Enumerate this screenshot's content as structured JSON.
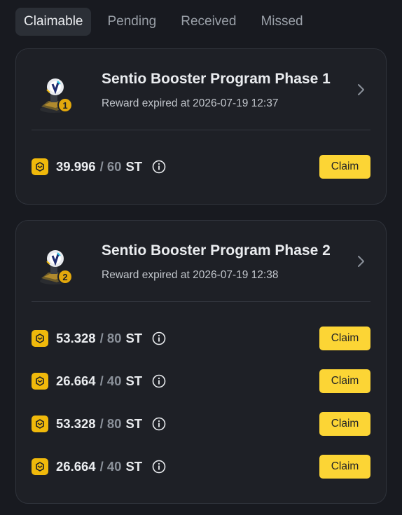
{
  "tabs": [
    {
      "label": "Claimable",
      "active": true
    },
    {
      "label": "Pending",
      "active": false
    },
    {
      "label": "Received",
      "active": false
    },
    {
      "label": "Missed",
      "active": false
    }
  ],
  "programs": [
    {
      "title": "Sentio Booster Program Phase 1",
      "subtitle": "Reward expired at 2026-07-19 12:37",
      "badge_number": "1",
      "rewards": [
        {
          "amount": "39.996",
          "total": "/ 60",
          "unit": "ST",
          "claim_label": "Claim"
        }
      ]
    },
    {
      "title": "Sentio Booster Program Phase 2",
      "subtitle": "Reward expired at 2026-07-19 12:38",
      "badge_number": "2",
      "rewards": [
        {
          "amount": "53.328",
          "total": "/ 80",
          "unit": "ST",
          "claim_label": "Claim"
        },
        {
          "amount": "26.664",
          "total": "/ 40",
          "unit": "ST",
          "claim_label": "Claim"
        },
        {
          "amount": "53.328",
          "total": "/ 80",
          "unit": "ST",
          "claim_label": "Claim"
        },
        {
          "amount": "26.664",
          "total": "/ 40",
          "unit": "ST",
          "claim_label": "Claim"
        }
      ]
    }
  ],
  "icons": {
    "badge": "trophy-badge-icon",
    "chevron": "chevron-right-icon",
    "coin": "voucher-coin-icon",
    "info": "info-circle-icon"
  },
  "colors": {
    "background": "#181a20",
    "card": "#1e2026",
    "accent": "#fcd535",
    "coin": "#f0b90b",
    "muted": "#8a9099"
  }
}
